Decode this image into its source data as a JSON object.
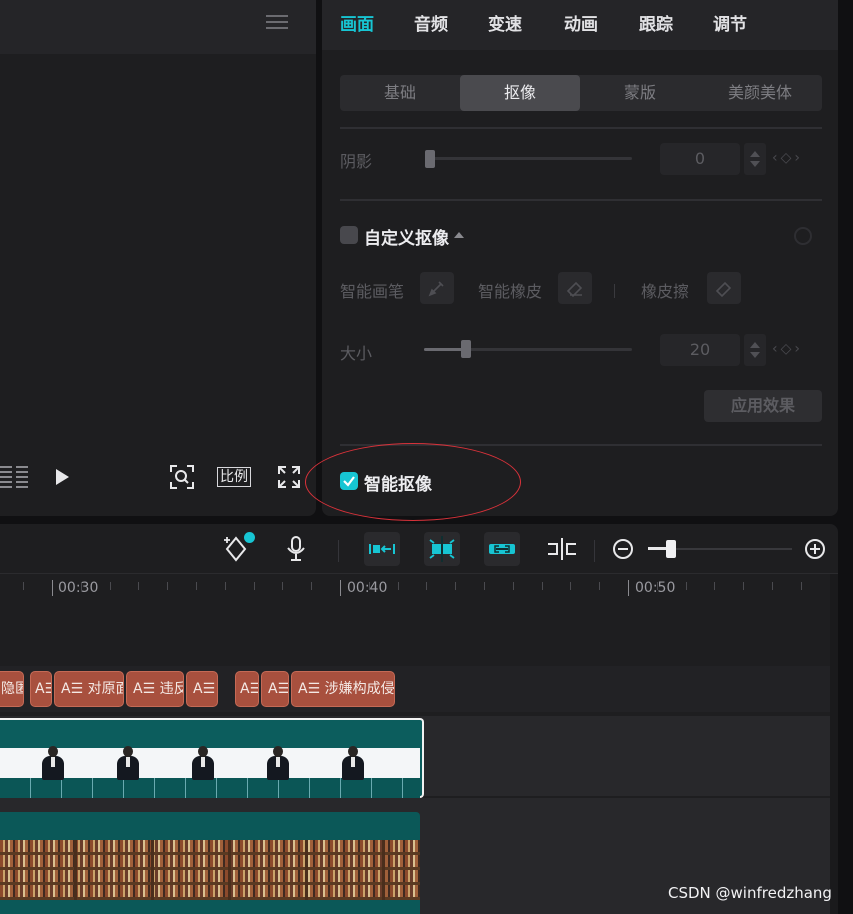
{
  "property_panel": {
    "tabs": [
      {
        "label": "画面",
        "active": true
      },
      {
        "label": "音频",
        "active": false
      },
      {
        "label": "变速",
        "active": false
      },
      {
        "label": "动画",
        "active": false
      },
      {
        "label": "跟踪",
        "active": false
      },
      {
        "label": "调节",
        "active": false
      }
    ],
    "subtabs": [
      {
        "label": "基础",
        "active": false
      },
      {
        "label": "抠像",
        "active": true
      },
      {
        "label": "蒙版",
        "active": false
      },
      {
        "label": "美颜美体",
        "active": false
      }
    ],
    "shadow": {
      "label": "阴影",
      "value": "0",
      "level": 0
    },
    "custom_matting": {
      "label": "自定义抠像",
      "checked": false
    },
    "tools": {
      "smart_brush": "智能画笔",
      "smart_eraser": "智能橡皮",
      "eraser": "橡皮擦"
    },
    "size": {
      "label": "大小",
      "value": "20",
      "level": 0.2
    },
    "apply_button": "应用效果",
    "smart_matting": {
      "label": "智能抠像",
      "checked": true
    }
  },
  "preview": {
    "ratio_label": "比例"
  },
  "timeline": {
    "ruler_labels": [
      "00:30",
      "00:40",
      "00:50"
    ],
    "zoom_level": 0.15,
    "text_clips": [
      "隐匿",
      "A☰",
      "A☰ 对原面",
      "A☰ 违反",
      "A☰",
      "A☰",
      "A☰",
      "A☰ 涉嫌构成侵"
    ]
  },
  "colors": {
    "accent": "#17c5d3",
    "highlight_ring": "#d8323a",
    "text_clip": "#a8503e",
    "video_clip": "#0c5d5d"
  },
  "watermark": "CSDN @winfredzhang"
}
